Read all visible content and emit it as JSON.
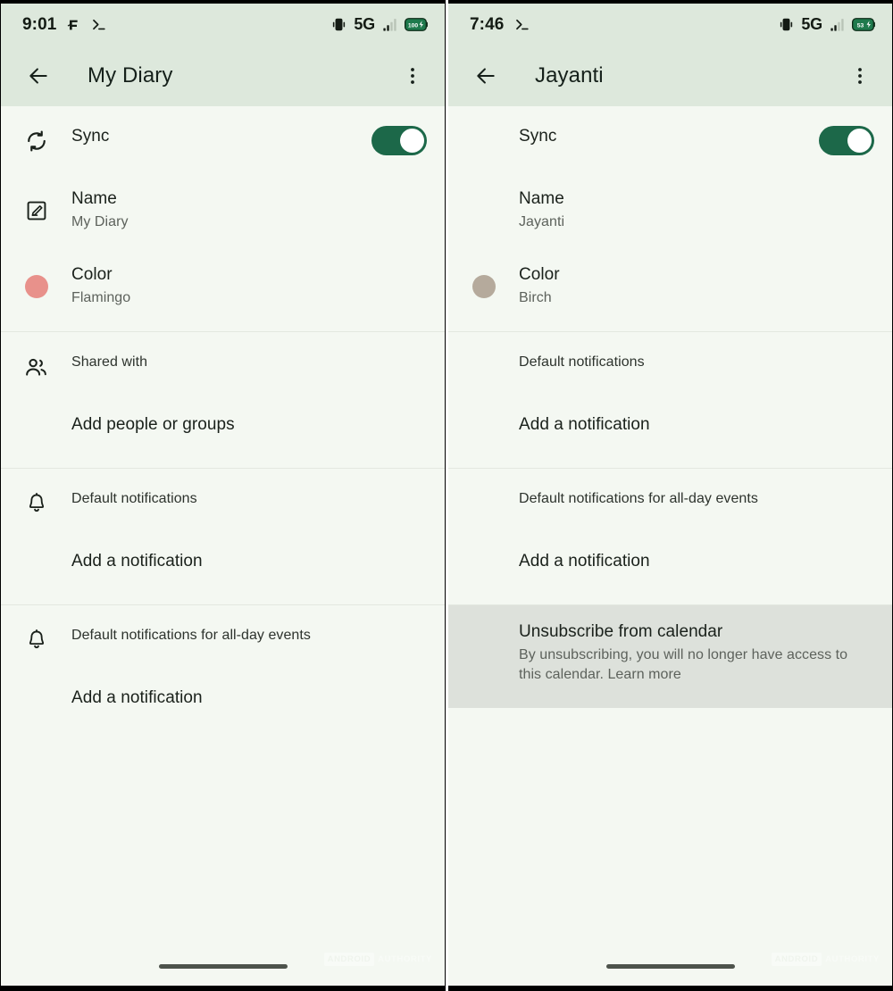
{
  "panels": [
    {
      "id": "left",
      "status": {
        "clock": "9:01",
        "left_icons": [
          "f-app-icon",
          "terminal-icon"
        ],
        "vibrate_icon": "vibrate-icon",
        "network": "5G",
        "signal_icon": "signal-bars-icon",
        "battery_level": "100",
        "battery_charging": true
      },
      "appbar": {
        "back_icon": "back-arrow-icon",
        "title": "My Diary",
        "overflow_icon": "more-vert-icon"
      },
      "sections": [
        {
          "rows": [
            {
              "icon": "sync-icon",
              "title": "Sync",
              "subtitle": "",
              "control": "toggle",
              "toggle_on": true
            },
            {
              "icon": "edit-square-icon",
              "title": "Name",
              "subtitle": "My Diary",
              "control": "none"
            },
            {
              "icon": "color-dot",
              "dot_color": "#e8918b",
              "title": "Color",
              "subtitle": "Flamingo",
              "control": "none"
            }
          ]
        },
        {
          "rows": [
            {
              "icon": "people-icon",
              "title": "Shared with",
              "small": true,
              "control": "none"
            },
            {
              "icon": "",
              "title": "Add people or groups",
              "control": "none"
            }
          ]
        },
        {
          "rows": [
            {
              "icon": "bell-icon",
              "title": "Default notifications",
              "small": true,
              "control": "none"
            },
            {
              "icon": "",
              "title": "Add a notification",
              "control": "none"
            }
          ]
        },
        {
          "rows": [
            {
              "icon": "bell-icon",
              "title": "Default notifications for all-day events",
              "small": true,
              "control": "none"
            },
            {
              "icon": "",
              "title": "Add a notification",
              "control": "none"
            }
          ]
        }
      ],
      "watermark": {
        "badge": "ANDROID",
        "text": "AUTHORITY"
      }
    },
    {
      "id": "right",
      "status": {
        "clock": "7:46",
        "left_icons": [
          "terminal-icon"
        ],
        "vibrate_icon": "vibrate-icon",
        "network": "5G",
        "signal_icon": "signal-bars-icon",
        "battery_level": "53",
        "battery_charging": true
      },
      "appbar": {
        "back_icon": "back-arrow-icon",
        "title": "Jayanti",
        "overflow_icon": "more-vert-icon"
      },
      "sections": [
        {
          "rows": [
            {
              "icon": "",
              "title": "Sync",
              "control": "toggle",
              "toggle_on": true
            },
            {
              "icon": "",
              "title": "Name",
              "subtitle": "Jayanti",
              "control": "none"
            },
            {
              "icon": "color-dot",
              "dot_color": "#b5aa9c",
              "title": "Color",
              "subtitle": "Birch",
              "control": "none"
            }
          ]
        },
        {
          "rows": [
            {
              "icon": "",
              "title": "Default notifications",
              "small": true,
              "control": "none"
            },
            {
              "icon": "",
              "title": "Add a notification",
              "control": "none"
            }
          ]
        },
        {
          "rows": [
            {
              "icon": "",
              "title": "Default notifications for all-day events",
              "small": true,
              "control": "none"
            },
            {
              "icon": "",
              "title": "Add a notification",
              "control": "none"
            }
          ]
        },
        {
          "highlighted": true,
          "rows": [
            {
              "icon": "",
              "title": "Unsubscribe from calendar",
              "subtitle": "By unsubscribing, you will no longer have access to this calendar. Learn more",
              "control": "none"
            }
          ]
        }
      ],
      "watermark": {
        "badge": "ANDROID",
        "text": "AUTHORITY"
      }
    }
  ],
  "theme": {
    "header_bg": "#dde8dc",
    "body_bg": "#f4f8f2",
    "toggle_on_color": "#1c6849",
    "highlight_bg": "#dde1db",
    "divider": "#e3e8e0"
  }
}
